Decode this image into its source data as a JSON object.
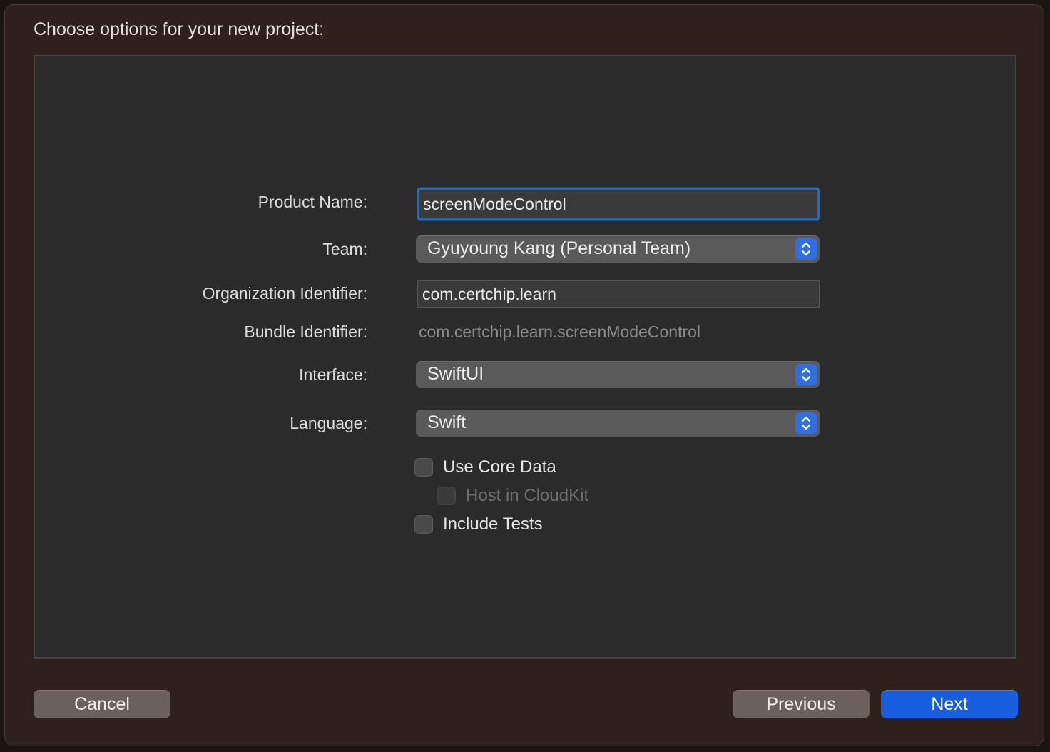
{
  "dialog": {
    "title": "Choose options for your new project:"
  },
  "form": {
    "product_name": {
      "label": "Product Name:",
      "value": "screenModeControl"
    },
    "team": {
      "label": "Team:",
      "value": "Gyuyoung Kang (Personal Team)"
    },
    "organization_identifier": {
      "label": "Organization Identifier:",
      "value": "com.certchip.learn"
    },
    "bundle_identifier": {
      "label": "Bundle Identifier:",
      "value": "com.certchip.learn.screenModeControl"
    },
    "interface": {
      "label": "Interface:",
      "value": "SwiftUI"
    },
    "language": {
      "label": "Language:",
      "value": "Swift"
    },
    "use_core_data": {
      "label": "Use Core Data",
      "checked": false,
      "enabled": true
    },
    "host_in_cloudkit": {
      "label": "Host in CloudKit",
      "checked": false,
      "enabled": false
    },
    "include_tests": {
      "label": "Include Tests",
      "checked": false,
      "enabled": true
    }
  },
  "buttons": {
    "cancel": "Cancel",
    "previous": "Previous",
    "next": "Next"
  },
  "colors": {
    "window_bg": "#2e201b",
    "panel_bg": "#2b2b2b",
    "accent_blue": "#1a5ee0",
    "focus_ring": "#2a6ab3"
  }
}
